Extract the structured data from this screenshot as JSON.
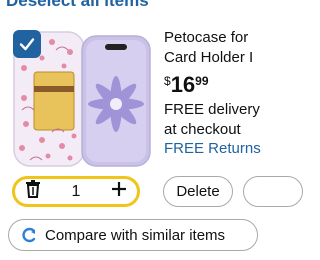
{
  "section": {
    "heading": "Deselect all items"
  },
  "item": {
    "title_line1": "Petocase for",
    "title_line2": "Card Holder I",
    "price_symbol": "$",
    "price_whole": "16",
    "price_fraction": "99",
    "delivery_line1": "FREE delivery",
    "delivery_line2": "at checkout",
    "returns_text": "FREE Returns",
    "selected": true,
    "image_icon": "phone-case-image"
  },
  "quantity": {
    "value": "1",
    "decrement_icon": "trash-icon",
    "increment_icon": "plus-icon"
  },
  "actions": {
    "delete_label": "Delete"
  },
  "compare": {
    "label": "Compare with similar items",
    "icon": "compare-icon"
  },
  "colors": {
    "accent": "#2162a1",
    "highlight": "#f0c419",
    "border": "#a9a9a9"
  }
}
